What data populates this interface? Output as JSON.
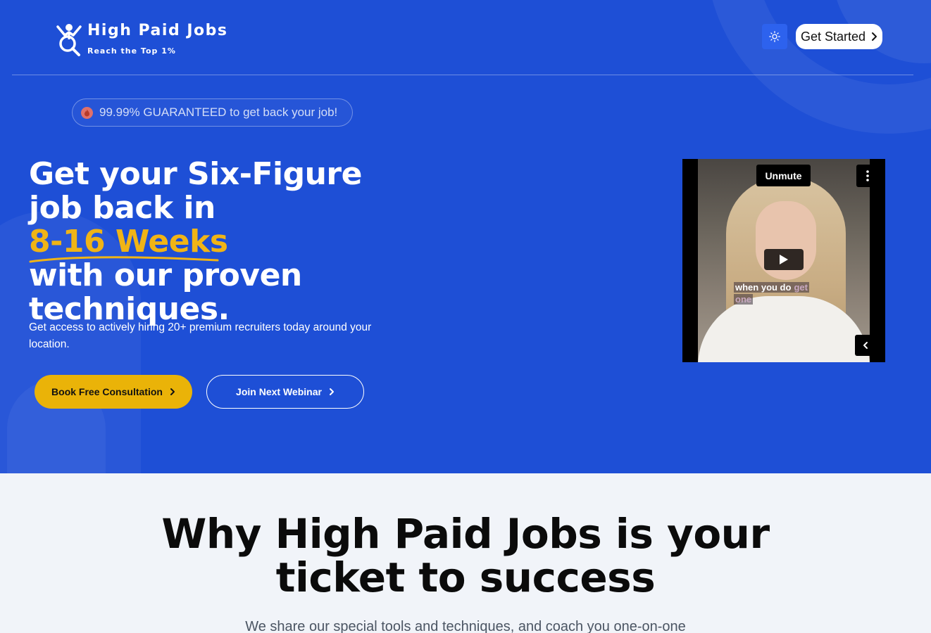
{
  "brand": {
    "name": "High Paid Jobs",
    "tagline": "Reach the Top 1%",
    "logo_icon": "person-magnifier-logo"
  },
  "header": {
    "theme_toggle_icon": "sun-icon",
    "cta_label": "Get Started"
  },
  "hero": {
    "promo": "99.99% GUARANTEED to get back your job!",
    "promo_icon": "fire-icon",
    "headline_line1": "Get your Six-Figure",
    "headline_line2_pre": "job back in ",
    "headline_highlight": "8-16 Weeks",
    "headline_line3": "with our proven",
    "headline_line4": "techniques.",
    "subtext": "Get access to actively hiring 20+ premium recruiters today around your location.",
    "primary_button": "Book Free Consultation",
    "secondary_button": "Join Next Webinar"
  },
  "video": {
    "unmute_label": "Unmute",
    "caption_part1": "when you do",
    "caption_part2": "get",
    "caption_part3": "one"
  },
  "section": {
    "title_line1": "Why High Paid Jobs is your",
    "title_line2": "ticket to success",
    "subtitle": "We share our special tools and techniques, and coach you one-on-one"
  },
  "colors": {
    "hero_bg": "#1e4fd6",
    "accent_yellow": "#eab308",
    "highlight_text": "#f0b416",
    "page_bg": "#f1f4f9"
  }
}
